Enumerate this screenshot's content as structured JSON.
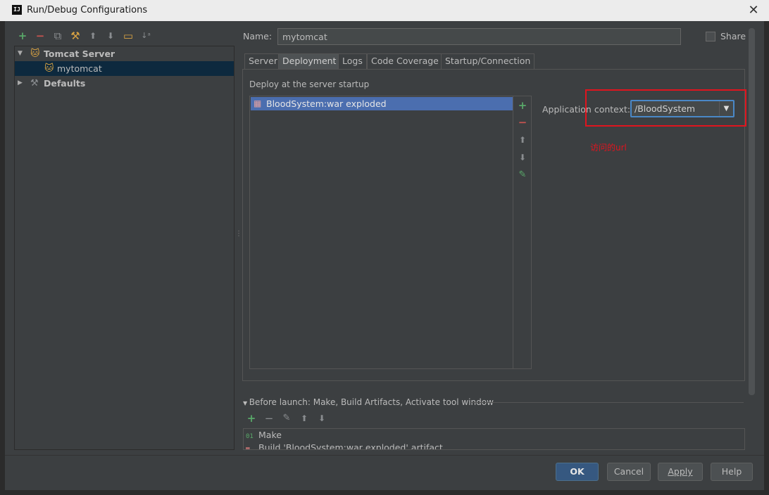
{
  "window": {
    "title": "Run/Debug Configurations",
    "logo": "IJ",
    "close_glyph": "✕"
  },
  "toolbar": {
    "add": "+",
    "remove": "−",
    "copy": "⧉",
    "edit_defaults": "⚒",
    "move_up": "⬆",
    "move_down": "⬇",
    "folder": "▭",
    "sort": "↓ᵃ"
  },
  "tree": [
    {
      "label": "Tomcat Server",
      "expanded": true,
      "bold": true
    },
    {
      "label": "mytomcat",
      "selected": true
    },
    {
      "label": "Defaults",
      "expanded": false,
      "bold": true
    }
  ],
  "config": {
    "name_label": "Name:",
    "name_value": "mytomcat",
    "share_label": "Share",
    "share_checked": false
  },
  "tabs": [
    "Server",
    "Deployment",
    "Logs",
    "Code Coverage",
    "Startup/Connection"
  ],
  "active_tab": "Deployment",
  "deployment": {
    "section_label": "Deploy at the server startup",
    "items": [
      "BloodSystem:war exploded"
    ],
    "context_label": "Application context:",
    "context_value": "/BloodSystem",
    "annotation": "访问的url"
  },
  "before_launch": {
    "label": "Before launch: Make, Build Artifacts, Activate tool window",
    "tasks": [
      "Make",
      "Build 'BloodSystem:war exploded' artifact"
    ]
  },
  "buttons": {
    "ok": "OK",
    "cancel": "Cancel",
    "apply": "Apply",
    "help": "Help"
  },
  "colors": {
    "accent": "#365880",
    "selection": "#4b6eaf",
    "annotation": "#e0141e"
  }
}
